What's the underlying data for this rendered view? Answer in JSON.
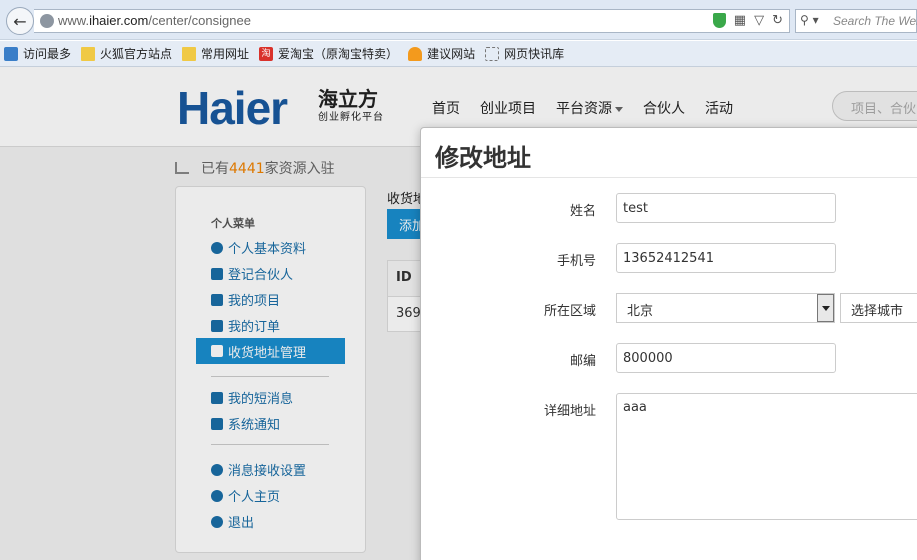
{
  "browser": {
    "url_prefix": "www.",
    "url_domain": "ihaier.com",
    "url_path": "/center/consignee",
    "search_placeholder": "Search The Web",
    "bookmarks": [
      "访问最多",
      "火狐官方站点",
      "常用网址",
      "爱淘宝（原淘宝特卖）",
      "建议网站",
      "网页快讯库"
    ],
    "taobao_badge": "淘"
  },
  "site": {
    "logo": "Haier",
    "logo_cn": "海立方",
    "logo_tag": "创业孵化平台",
    "nav": [
      "首页",
      "创业项目",
      "平台资源",
      "合伙人",
      "活动"
    ],
    "search_placeholder": "项目、合伙"
  },
  "stats": {
    "prefix": "已有",
    "count": "4441",
    "suffix": "家资源入驻"
  },
  "sidebar": {
    "title": "个人菜单",
    "items": [
      "个人基本资料",
      "登记合伙人",
      "我的项目",
      "我的订单",
      "收货地址管理",
      "我的短消息",
      "系统通知",
      "消息接收设置",
      "个人主页",
      "退出"
    ]
  },
  "content": {
    "label": "收货地",
    "add_button": "添加",
    "col_id": "ID",
    "row_id": "369"
  },
  "modal": {
    "title": "修改地址",
    "name_label": "姓名",
    "name_value": "test",
    "phone_label": "手机号",
    "phone_value": "13652412541",
    "region_label": "所在区域",
    "province": "北京",
    "city": "选择城市",
    "zip_label": "邮编",
    "zip_value": "800000",
    "address_label": "详细地址",
    "address_value": "aaa"
  }
}
